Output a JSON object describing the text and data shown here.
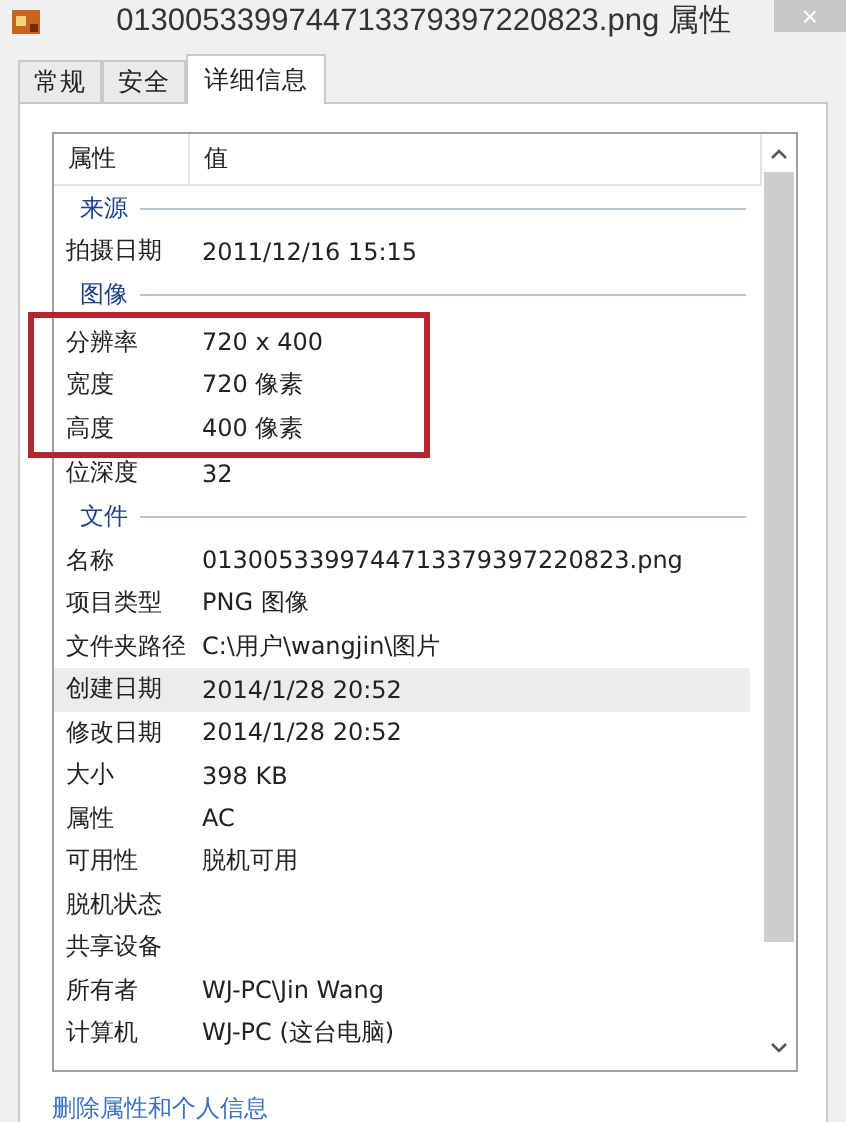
{
  "window": {
    "title": "0130053399744713379397220823.png 属性",
    "close": "×"
  },
  "tabs": [
    {
      "label": "常规",
      "selected": false
    },
    {
      "label": "安全",
      "selected": false
    },
    {
      "label": "详细信息",
      "selected": true
    }
  ],
  "list": {
    "columns": [
      "属性",
      "值"
    ],
    "sections": [
      {
        "title": "来源",
        "rows": [
          {
            "label": "拍摄日期",
            "value": "2011/12/16 15:15",
            "selected": false,
            "boxed": false
          }
        ]
      },
      {
        "title": "图像",
        "rows": [
          {
            "label": "分辨率",
            "value": "720 x 400",
            "selected": false,
            "boxed": true
          },
          {
            "label": "宽度",
            "value": "720 像素",
            "selected": false,
            "boxed": true
          },
          {
            "label": "高度",
            "value": "400 像素",
            "selected": false,
            "boxed": true
          },
          {
            "label": "位深度",
            "value": "32",
            "selected": false,
            "boxed": false
          }
        ]
      },
      {
        "title": "文件",
        "rows": [
          {
            "label": "名称",
            "value": "0130053399744713379397220823.png",
            "selected": false,
            "boxed": false
          },
          {
            "label": "项目类型",
            "value": "PNG 图像",
            "selected": false,
            "boxed": false
          },
          {
            "label": "文件夹路径",
            "value": "C:\\用户\\wangjin\\图片",
            "selected": false,
            "boxed": false
          },
          {
            "label": "创建日期",
            "value": "2014/1/28 20:52",
            "selected": true,
            "boxed": false
          },
          {
            "label": "修改日期",
            "value": "2014/1/28 20:52",
            "selected": false,
            "boxed": false
          },
          {
            "label": "大小",
            "value": "398 KB",
            "selected": false,
            "boxed": false
          },
          {
            "label": "属性",
            "value": "AC",
            "selected": false,
            "boxed": false
          },
          {
            "label": "可用性",
            "value": "脱机可用",
            "selected": false,
            "boxed": false
          },
          {
            "label": "脱机状态",
            "selected": false,
            "boxed": false
          },
          {
            "label": "共享设备",
            "selected": false,
            "boxed": false
          },
          {
            "label": "所有者",
            "value": "WJ-PC\\Jin Wang",
            "selected": false,
            "boxed": false
          },
          {
            "label": "计算机",
            "value": "WJ-PC (这台电脑)",
            "selected": false,
            "boxed": false
          }
        ]
      }
    ]
  },
  "link": "删除属性和个人信息"
}
